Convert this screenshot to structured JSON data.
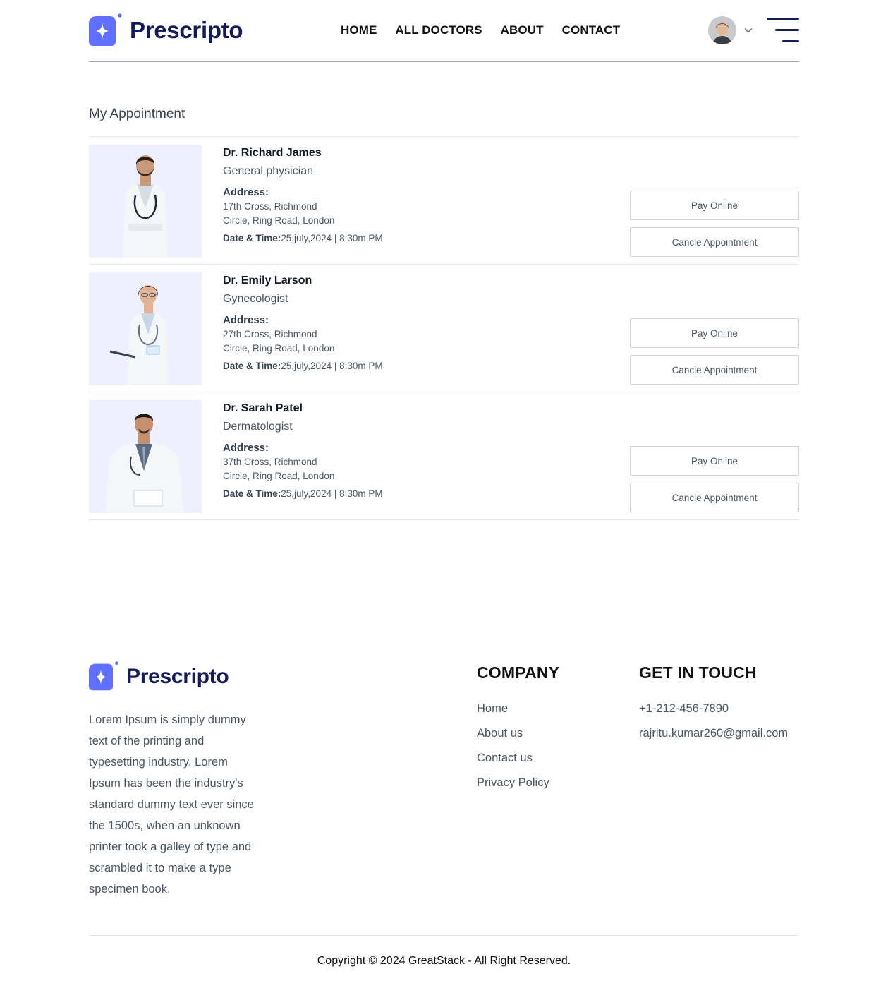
{
  "header": {
    "brand": "Prescripto",
    "nav": [
      "HOME",
      "ALL DOCTORS",
      "ABOUT",
      "CONTACT"
    ],
    "icons": {
      "logo": "prescripto-logo-icon",
      "avatar": "user-avatar",
      "dropdown": "chevron-down-icon",
      "menu": "hamburger-menu-icon"
    },
    "brand_color": "#5f6fff"
  },
  "main": {
    "title": "My Appointment",
    "address_label": "Address:",
    "datetime_label": "Date & Time:",
    "pay_label": "Pay Online",
    "cancel_label": "Cancle Appointment",
    "appointments": [
      {
        "name": "Dr. Richard James",
        "speciality": "General physician",
        "address_line1": "17th Cross, Richmond",
        "address_line2": "Circle, Ring Road, London",
        "datetime": "25,july,2024 | 8:30m PM"
      },
      {
        "name": "Dr. Emily Larson",
        "speciality": "Gynecologist",
        "address_line1": "27th Cross, Richmond",
        "address_line2": "Circle, Ring Road, London",
        "datetime": "25,july,2024 | 8:30m PM"
      },
      {
        "name": "Dr. Sarah Patel",
        "speciality": "Dermatologist",
        "address_line1": "37th Cross, Richmond",
        "address_line2": "Circle, Ring Road, London",
        "datetime": "25,july,2024 | 8:30m PM"
      }
    ]
  },
  "footer": {
    "brand": "Prescripto",
    "description": "Lorem Ipsum is simply dummy text of the printing and typesetting industry. Lorem Ipsum has been the industry's standard dummy text ever since the 1500s, when an unknown printer took a galley of type and scrambled it to make a type specimen book.",
    "company_heading": "COMPANY",
    "company_links": [
      "Home",
      "About us",
      "Contact us",
      "Privacy Policy"
    ],
    "contact_heading": "GET IN TOUCH",
    "phone": "+1-212-456-7890",
    "email": "rajritu.kumar260@gmail.com",
    "copyright": "Copyright © 2024 GreatStack - All Right Reserved."
  }
}
